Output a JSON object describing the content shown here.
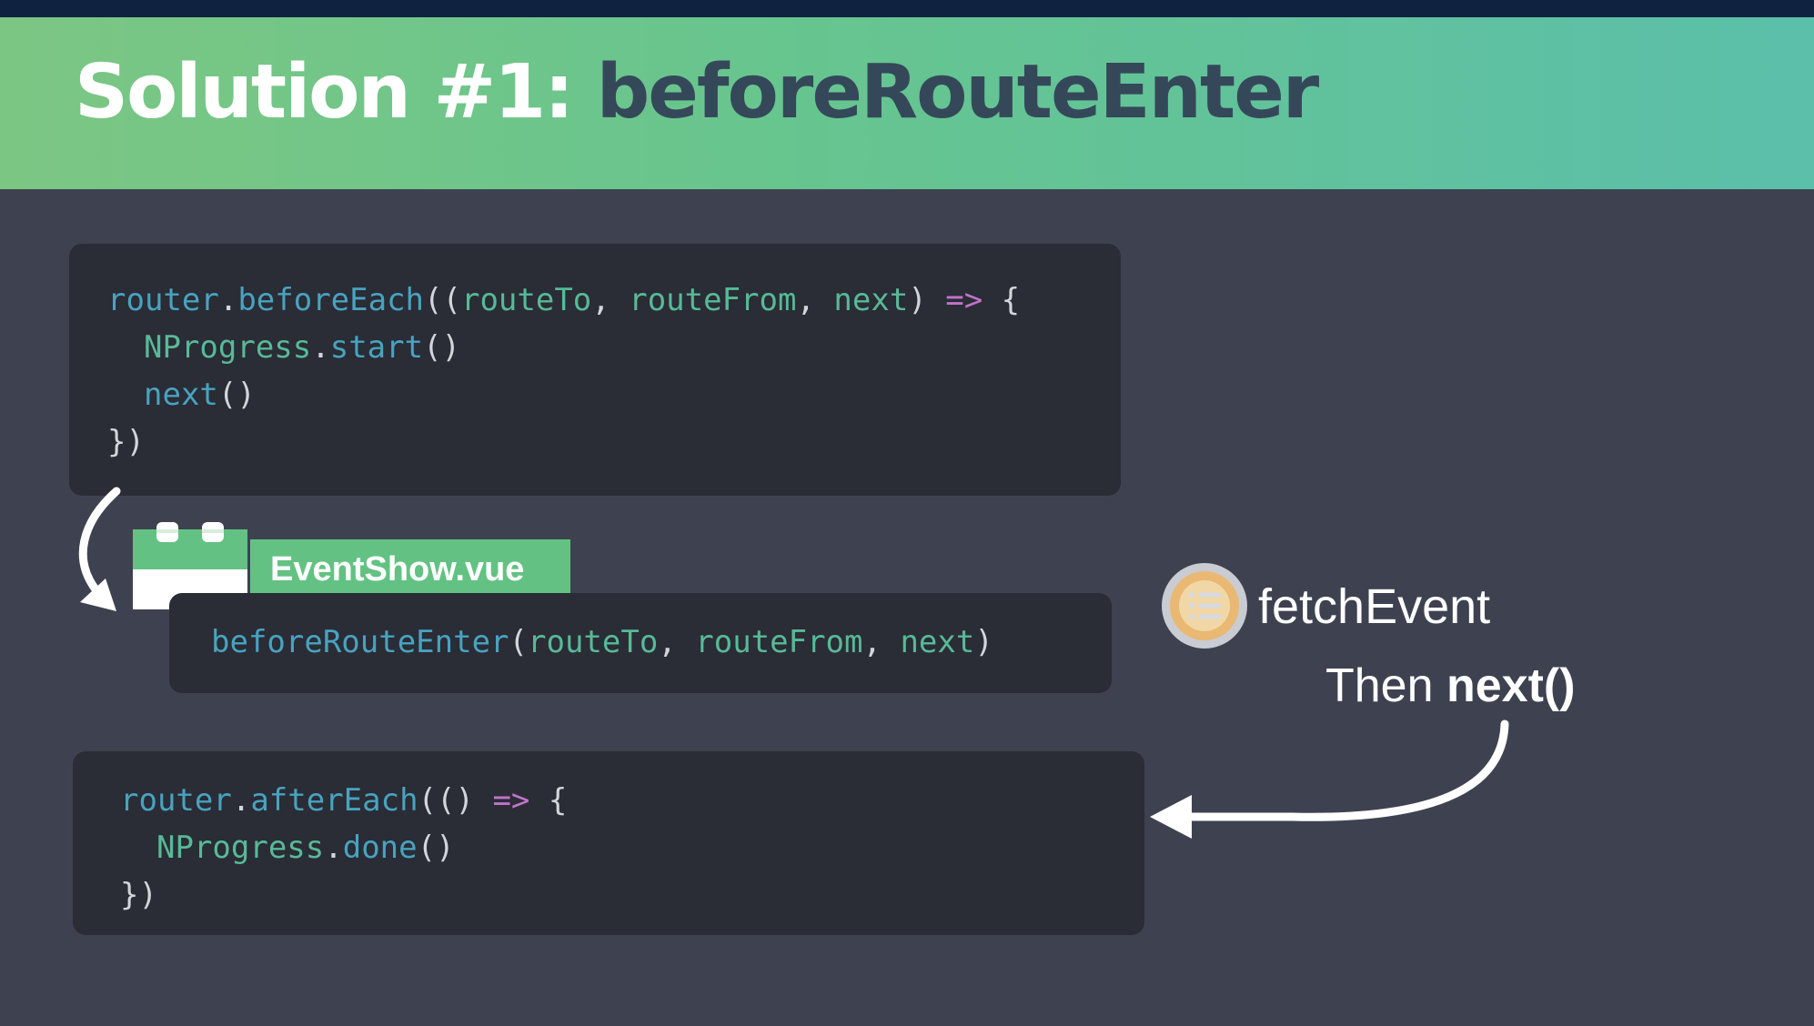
{
  "slide": {
    "title_prefix": "Solution #1:",
    "title_name": "beforeRouteEnter"
  },
  "code_before_each": {
    "l1": {
      "a": "router",
      "b": ".",
      "c": "beforeEach",
      "d": "((",
      "e": "routeTo",
      "f": ", ",
      "g": "routeFrom",
      "h": ", ",
      "i": "next",
      "j": ") ",
      "k": "=>",
      "l": " {"
    },
    "l2": {
      "a": "NProgress",
      "b": ".",
      "c": "start",
      "d": "()"
    },
    "l3": {
      "a": "next",
      "b": "()"
    },
    "l4": {
      "a": "})"
    }
  },
  "component": {
    "name": "EventShow.vue",
    "icon": "component-block-icon",
    "hook": {
      "a": "beforeRouteEnter",
      "b": "(",
      "c": "routeTo",
      "d": ", ",
      "e": "routeFrom",
      "f": ", ",
      "g": "next",
      "h": ")"
    }
  },
  "fetch": {
    "icon": "list-document-icon",
    "label": "fetchEvent",
    "then_prefix": "Then ",
    "then_call": "next()"
  },
  "code_after_each": {
    "l1": {
      "a": "router",
      "b": ".",
      "c": "afterEach",
      "d": "(() ",
      "e": "=>",
      "f": " {"
    },
    "l2": {
      "a": "NProgress",
      "b": ".",
      "c": "done",
      "d": "()"
    },
    "l3": {
      "a": "})"
    }
  },
  "colors": {
    "background": "#3e4250",
    "header_start": "#7cc683",
    "header_end": "#5bbfaa",
    "title_name": "#35485a",
    "code_bg": "#2a2c36",
    "keyword": "#48a3bf",
    "param": "#57ba96",
    "operator": "#c074c8",
    "tag": "#63c283"
  }
}
